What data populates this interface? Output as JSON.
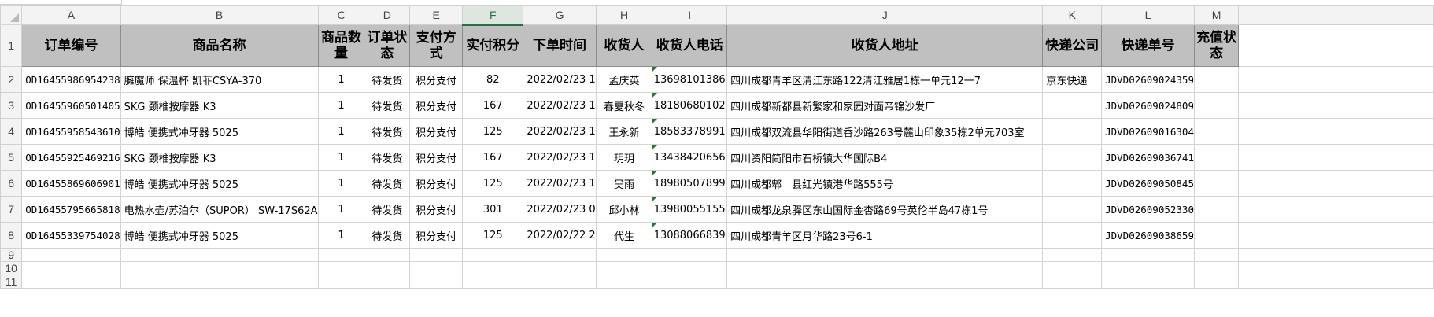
{
  "columns": [
    "A",
    "B",
    "C",
    "D",
    "E",
    "F",
    "G",
    "H",
    "I",
    "J",
    "K",
    "L",
    "M"
  ],
  "selected_column": "F",
  "header_row": {
    "row_number": "1",
    "cells": [
      "订单编号",
      "商品名称",
      "商品数量",
      "订单状态",
      "支付方式",
      "实付积分",
      "下单时间",
      "收货人",
      "收货人电话",
      "收货人地址",
      "快递公司",
      "快递单号",
      "充值状态"
    ]
  },
  "rows": [
    {
      "row_number": "2",
      "order_no": "OD16455986954238",
      "product": "臃魔师 保温杯 凯菲CSYA-370",
      "qty": "1",
      "status": "待发货",
      "pay": "积分支付",
      "points": "82",
      "time": "2022/02/23 1",
      "receiver": "孟庆英",
      "phone": "13698101386",
      "address": "四川成都青羊区清江东路122清江雅居1栋一单元12一7",
      "courier": "京东快递",
      "tracking": "JDVD02609024359",
      "recharge": ""
    },
    {
      "row_number": "3",
      "order_no": "OD16455960501405",
      "product": "SKG 颈椎按摩器 K3",
      "qty": "1",
      "status": "待发货",
      "pay": "积分支付",
      "points": "167",
      "time": "2022/02/23 1",
      "receiver": "春夏秋冬",
      "phone": "18180680102",
      "address": "四川成都新都县新繁家和家园对面帝锦沙发厂",
      "courier": "",
      "tracking": "JDVD02609024809",
      "recharge": ""
    },
    {
      "row_number": "4",
      "order_no": "OD16455958543610",
      "product": "博皓 便携式冲牙器 5025",
      "qty": "1",
      "status": "待发货",
      "pay": "积分支付",
      "points": "125",
      "time": "2022/02/23 1",
      "receiver": "王永新",
      "phone": "18583378991",
      "address": "四川成都双流县华阳街道香沙路263号麓山印象35栋2单元703室",
      "courier": "",
      "tracking": "JDVD02609016304",
      "recharge": ""
    },
    {
      "row_number": "5",
      "order_no": "OD16455925469216",
      "product": "SKG 颈椎按摩器 K3",
      "qty": "1",
      "status": "待发货",
      "pay": "积分支付",
      "points": "167",
      "time": "2022/02/23 1",
      "receiver": "玥玥",
      "phone": "13438420656",
      "address": "四川资阳简阳市石桥镇大华国际B4",
      "courier": "",
      "tracking": "JDVD02609036741",
      "recharge": ""
    },
    {
      "row_number": "6",
      "order_no": "OD16455869606901",
      "product": "博皓 便携式冲牙器 5025",
      "qty": "1",
      "status": "待发货",
      "pay": "积分支付",
      "points": "125",
      "time": "2022/02/23 1",
      "receiver": "吴雨",
      "phone": "18980507899",
      "address": "四川成都郫　县红光镇港华路555号",
      "courier": "",
      "tracking": "JDVD02609050845",
      "recharge": ""
    },
    {
      "row_number": "7",
      "order_no": "OD16455795665818",
      "product": "电热水壶/苏泊尔（SUPOR） SW-17S62A",
      "qty": "1",
      "status": "待发货",
      "pay": "积分支付",
      "points": "301",
      "time": "2022/02/23 0",
      "receiver": "邱小林",
      "phone": "13980055155",
      "address": "四川成都龙泉驿区东山国际金杏路69号英伦半岛47栋1号",
      "courier": "",
      "tracking": "JDVD02609052330",
      "recharge": ""
    },
    {
      "row_number": "8",
      "order_no": "OD16455339754028",
      "product": "博皓 便携式冲牙器 5025",
      "qty": "1",
      "status": "待发货",
      "pay": "积分支付",
      "points": "125",
      "time": "2022/02/22 2",
      "receiver": "代生",
      "phone": "13088066839",
      "address": "四川成都青羊区月华路23号6-1",
      "courier": "",
      "tracking": "JDVD02609038659",
      "recharge": ""
    }
  ],
  "empty_rows": [
    "9",
    "10",
    "11"
  ]
}
